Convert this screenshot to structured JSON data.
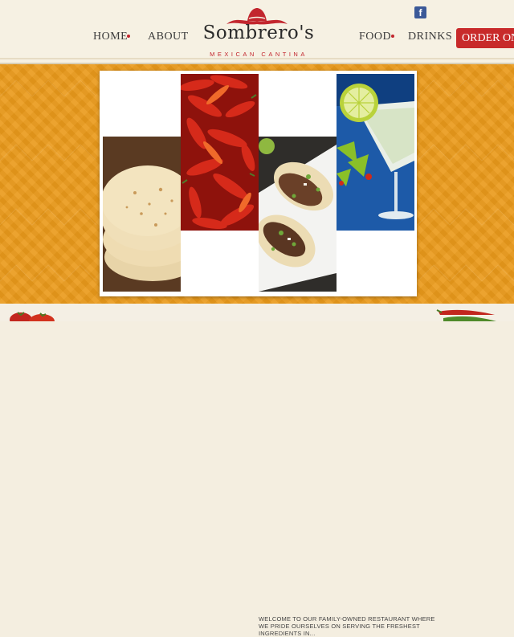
{
  "nav": {
    "home": "HOME",
    "about": "ABOUT",
    "food": "FOOD",
    "drinks": "DRINKS",
    "order_online": "ORDER ONLINE"
  },
  "logo": {
    "title": "Sombrero's",
    "subtitle": "MEXICAN CANTINA"
  },
  "social": {
    "facebook_glyph": "f"
  },
  "footer": {
    "welcome": "WELCOME TO OUR FAMILY-OWNED RESTAURANT WHERE WE PRIDE OURSELVES ON SERVING THE FRESHEST INGREDIENTS IN..."
  },
  "colors": {
    "accent_red": "#c82a2a",
    "band_orange": "#ea9a1b",
    "facebook_blue": "#3b5998"
  },
  "icons": [
    "facebook-icon",
    "sombrero-logo-icon",
    "tomato-icon",
    "chili-pepper-icon"
  ]
}
